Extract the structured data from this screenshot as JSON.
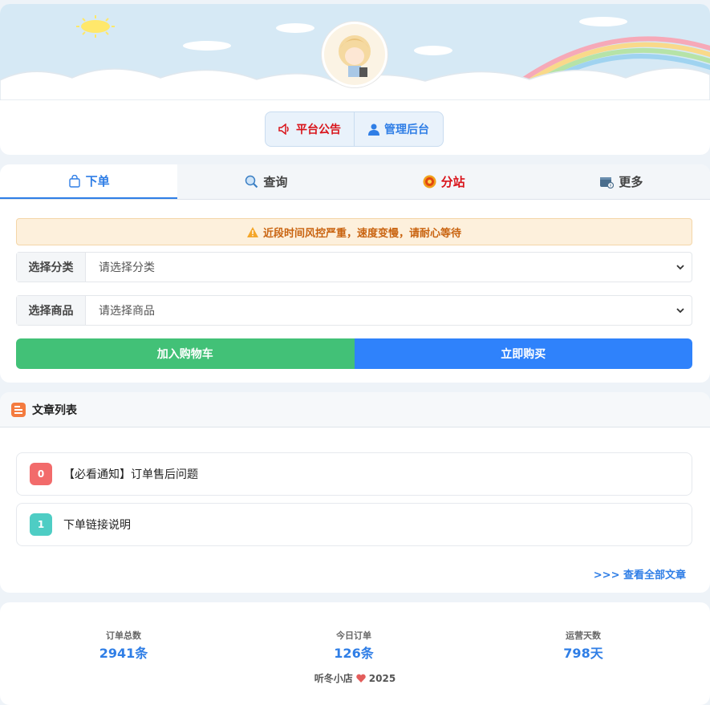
{
  "header": {
    "notice_button": "平台公告",
    "admin_button": "管理后台"
  },
  "tabs": [
    {
      "label": "下单",
      "icon": "shopping-bag-icon"
    },
    {
      "label": "查询",
      "icon": "magnifier-icon"
    },
    {
      "label": "分站",
      "icon": "coin-icon"
    },
    {
      "label": "更多",
      "icon": "wallet-icon"
    }
  ],
  "order_form": {
    "alert": "近段时间风控严重，速度变慢，请耐心等待",
    "category_label": "选择分类",
    "category_placeholder": "请选择分类",
    "product_label": "选择商品",
    "product_placeholder": "请选择商品",
    "add_to_cart": "加入购物车",
    "buy_now": "立即购买"
  },
  "articles": {
    "title": "文章列表",
    "items": [
      {
        "index": "0",
        "title": "【必看通知】订单售后问题",
        "color": "#f26b6b"
      },
      {
        "index": "1",
        "title": "下单链接说明",
        "color": "#4ecdc4"
      }
    ],
    "more_link": ">>> 查看全部文章"
  },
  "stats": {
    "total_label": "订单总数",
    "total_value": "2941条",
    "today_label": "今日订单",
    "today_value": "126条",
    "days_label": "运营天数",
    "days_value": "798天"
  },
  "footer": {
    "shop_name": "听冬小店",
    "year": "2025"
  },
  "colors": {
    "primary": "#2f7ee6",
    "success": "#42c177",
    "danger": "#d9141b",
    "warning_text": "#c9630f"
  }
}
